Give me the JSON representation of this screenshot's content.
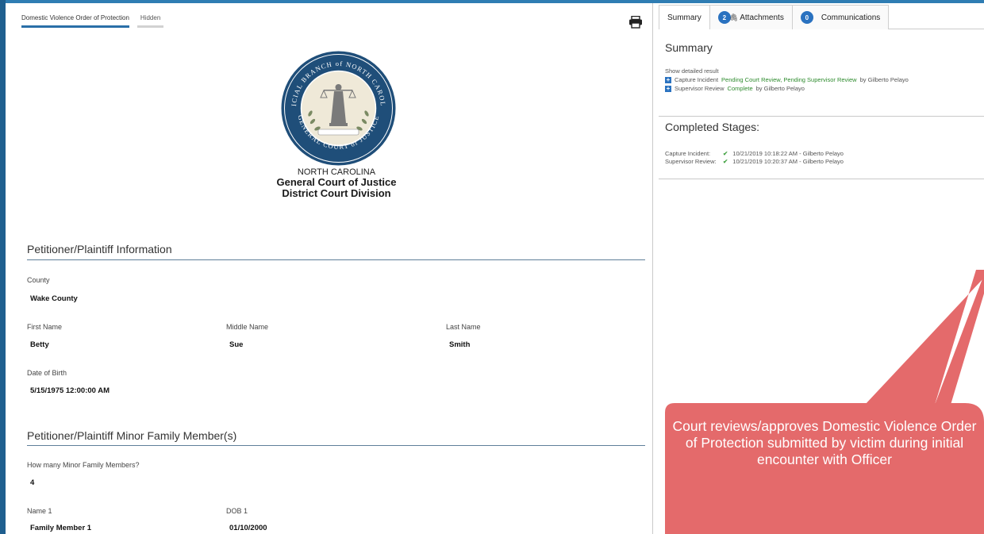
{
  "colors": {
    "accent": "#2a6fa8",
    "badge": "#2a72c0",
    "status_green": "#2e8b2e",
    "callout": "#e46a6b"
  },
  "document_tabs": [
    {
      "label": "Domestic Violence Order of Protection",
      "active": true
    },
    {
      "label": "Hidden",
      "active": false
    }
  ],
  "icons": {
    "print": "printer-icon",
    "seal": "court-seal-icon"
  },
  "seal": {
    "ring_text_top": "JUDICIAL BRANCH of NORTH CAROLINA",
    "ring_text_bottom": "GENERAL COURT of JUSTICE"
  },
  "court_header": {
    "state": "NORTH CAROLINA",
    "court": "General Court of Justice",
    "division": "District Court Division"
  },
  "petitioner_section": {
    "title": "Petitioner/Plaintiff Information",
    "county_label": "County",
    "county_value": "Wake County",
    "first_name_label": "First Name",
    "first_name_value": "Betty",
    "middle_name_label": "Middle Name",
    "middle_name_value": "Sue",
    "last_name_label": "Last Name",
    "last_name_value": "Smith",
    "dob_label": "Date of Birth",
    "dob_value": "5/15/1975 12:00:00 AM"
  },
  "minor_section": {
    "title": "Petitioner/Plaintiff Minor Family Member(s)",
    "count_label": "How many Minor Family Members?",
    "count_value": "4",
    "name1_label": "Name 1",
    "name1_value": "Family Member 1",
    "dob1_label": "DOB 1",
    "dob1_value": "01/10/2000"
  },
  "right_tabs": [
    {
      "label": "Summary",
      "badge": "",
      "active": true
    },
    {
      "label": "Attachments",
      "badge": "2",
      "active": false
    },
    {
      "label": "Communications",
      "badge": "0",
      "active": false
    }
  ],
  "summary": {
    "heading": "Summary",
    "show_detailed": "Show detailed result",
    "line1_stage": "Capture Incident",
    "line1_status": "Pending Court Review, Pending Supervisor Review",
    "line1_by": "by Gilberto Pelayo",
    "line2_stage": "Supervisor Review",
    "line2_status": "Complete",
    "line2_by": "by Gilberto Pelayo"
  },
  "completed_stages": {
    "heading": "Completed Stages:",
    "rows": [
      {
        "label": "Capture Incident:",
        "value": "10/21/2019 10:18:22 AM - Gilberto Pelayo"
      },
      {
        "label": "Supervisor Review:",
        "value": "10/21/2019 10:20:37 AM - Gilberto Pelayo"
      }
    ]
  },
  "callout": {
    "text": "Court reviews/approves Domestic Violence Order of Protection submitted by victim during initial encounter with Officer"
  }
}
